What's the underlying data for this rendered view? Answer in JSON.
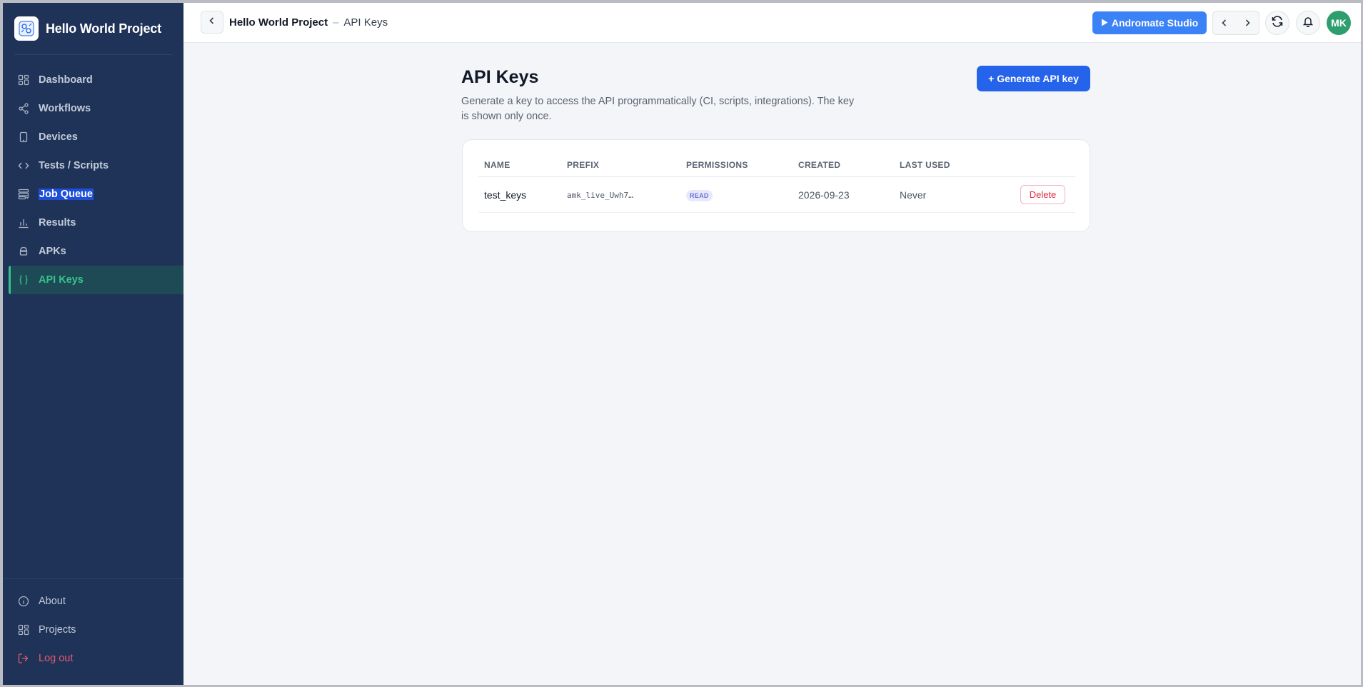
{
  "sidebar": {
    "project_title": "Hello World Project",
    "items": [
      {
        "label": "Dashboard",
        "icon": "dashboard-icon"
      },
      {
        "label": "Workflows",
        "icon": "share-icon"
      },
      {
        "label": "Devices",
        "icon": "phone-icon"
      },
      {
        "label": "Tests / Scripts",
        "icon": "code-icon"
      },
      {
        "label": "Job Queue",
        "icon": "queue-icon"
      },
      {
        "label": "Results",
        "icon": "bar-chart-icon"
      },
      {
        "label": "APKs",
        "icon": "android-icon"
      },
      {
        "label": "API Keys",
        "icon": "braces-icon",
        "active": true
      }
    ],
    "bottom_items": [
      {
        "label": "About",
        "icon": "info-icon"
      },
      {
        "label": "Projects",
        "icon": "grid-icon"
      },
      {
        "label": "Log out",
        "icon": "logout-icon"
      }
    ]
  },
  "topbar": {
    "project": "Hello World Project",
    "separator": "–",
    "page": "API Keys",
    "studio_label": "Andromate Studio",
    "avatar_initials": "MK"
  },
  "main": {
    "title": "API Keys",
    "description": "Generate a key to access the API programmatically (CI, scripts, integrations). The key is shown only once.",
    "generate_label": "+ Generate API key",
    "table": {
      "headers": [
        "NAME",
        "PREFIX",
        "PERMISSIONS",
        "CREATED",
        "LAST USED"
      ],
      "rows": [
        {
          "name": "test_keys",
          "prefix": "amk_live_Uwh7…",
          "permission": "READ",
          "created": "2026-09-23",
          "last_used": "Never",
          "action": "Delete"
        }
      ]
    }
  },
  "colors": {
    "sidebar_bg": "#1f3358",
    "accent_green": "#35c28c",
    "primary_blue": "#2563eb",
    "danger": "#dc2e44"
  }
}
